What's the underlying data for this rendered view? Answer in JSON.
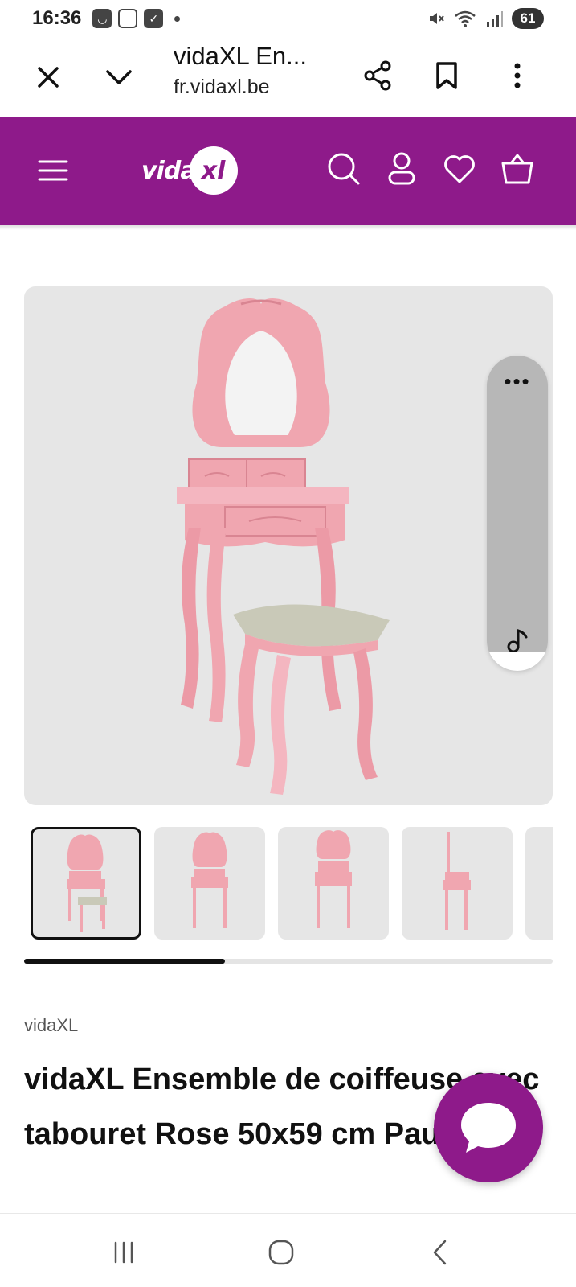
{
  "status_bar": {
    "time": "16:36",
    "battery": "61",
    "icons": [
      "notification-icon",
      "screenshot-icon",
      "check-icon",
      "mute-icon",
      "wifi-icon",
      "signal-icon"
    ]
  },
  "browser": {
    "title": "vidaXL En...",
    "url": "fr.vidaxl.be"
  },
  "site_header": {
    "logo_text": "vida",
    "logo_badge": "xl",
    "brand_color": "#8e1a8a"
  },
  "gallery": {
    "thumbnail_count": 5,
    "active_index": 0,
    "scroll_progress": 0.38
  },
  "side_widget": {
    "more_label": "•••"
  },
  "product": {
    "brand": "vidaXL",
    "title": "vidaXL Ensemble de coiffeuse avec tabouret Rose 50x59 cm Paulownia"
  },
  "colors": {
    "accent": "#8e1a8a",
    "furniture_pink": "#f0a6b0",
    "image_bg": "#e6e6e6"
  }
}
